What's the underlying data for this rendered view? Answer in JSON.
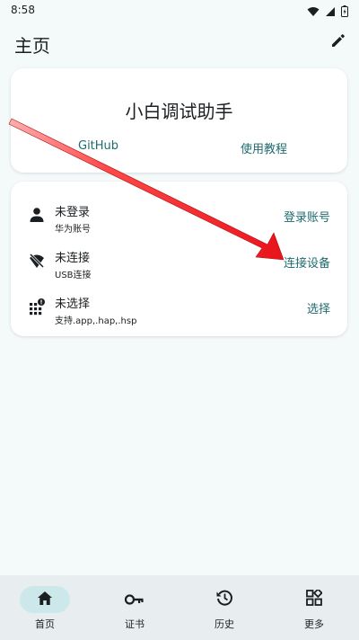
{
  "status_bar": {
    "time": "8:58",
    "icons": [
      "wifi-icon",
      "signal-icon",
      "battery-icon"
    ]
  },
  "top_bar": {
    "title": "主页",
    "edit_icon": "pencil-icon"
  },
  "app_card": {
    "title": "小白调试助手",
    "links": [
      "GitHub",
      "使用教程"
    ]
  },
  "status_card": {
    "rows": [
      {
        "title": "未登录",
        "subtitle": "华为账号",
        "action": "登录账号",
        "icon": "person-icon"
      },
      {
        "title": "未连接",
        "subtitle": "USB连接",
        "action": "连接设备",
        "icon": "wifi-off-icon"
      },
      {
        "title": "未选择",
        "subtitle": "支持.app,.hap,.hsp",
        "action": "选择",
        "icon": "apps-alert-icon"
      }
    ]
  },
  "bottom_nav": {
    "items": [
      {
        "label": "首页",
        "icon": "home-icon",
        "active": true
      },
      {
        "label": "证书",
        "icon": "key-icon",
        "active": false
      },
      {
        "label": "历史",
        "icon": "history-icon",
        "active": false
      },
      {
        "label": "更多",
        "icon": "grid-icon",
        "active": false
      }
    ]
  },
  "colors": {
    "background": "#f4f9fa",
    "accent": "#1f6b6e",
    "nav_background": "#e8eef0",
    "nav_active_pill": "#cde8ea",
    "annotation_arrow": "#e8131a"
  }
}
